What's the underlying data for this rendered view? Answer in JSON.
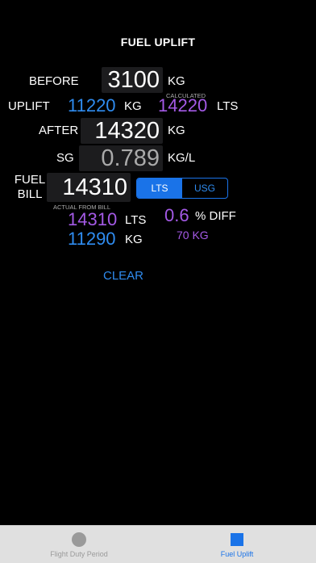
{
  "header": {
    "title": "FUEL UPLIFT"
  },
  "before": {
    "label": "BEFORE",
    "value": "3100",
    "unit": "KG"
  },
  "uplift": {
    "label": "UPLIFT",
    "value": "11220",
    "unit": "KG"
  },
  "calculated": {
    "caption": "CALCULATED",
    "value": "14220",
    "unit": "LTS"
  },
  "after": {
    "label": "AFTER",
    "value": "14320",
    "unit": "KG"
  },
  "sg": {
    "label": "SG",
    "value": "0.789",
    "unit": "KG/L"
  },
  "fuel_bill": {
    "label_line1": "FUEL",
    "label_line2": "BILL",
    "value": "14310"
  },
  "unit_toggle": {
    "options": [
      "LTS",
      "USG"
    ],
    "selected": "LTS",
    "accent": "#1a73e8"
  },
  "actual": {
    "caption": "ACTUAL FROM BILL",
    "lts_value": "14310",
    "lts_unit": "LTS",
    "kg_value": "11290",
    "kg_unit": "KG"
  },
  "diff": {
    "percent_value": "0.6",
    "percent_label": "% DIFF",
    "kg_value": "70 KG"
  },
  "clear_button": {
    "label": "CLEAR"
  },
  "tabs": [
    {
      "label": "Flight Duty Period",
      "icon": "circle-icon",
      "active": false
    },
    {
      "label": "Fuel Uplift",
      "icon": "square-icon",
      "active": true
    }
  ],
  "colors": {
    "blue": "#2f8cf0",
    "purple": "#a45ae6",
    "background": "#000000"
  }
}
